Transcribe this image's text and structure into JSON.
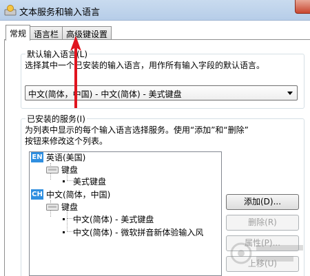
{
  "window": {
    "title": "文本服务和输入语言"
  },
  "tabs": [
    {
      "label": "常规",
      "active": true
    },
    {
      "label": "语言栏",
      "active": false
    },
    {
      "label": "高级键设置",
      "active": false
    }
  ],
  "default_language": {
    "legend": "默认输入语言(L)",
    "description": "选择其中一个已安装的输入语言，用作所有输入字段的默认语言。",
    "selected": "中文(简体，中国) - 中文(简体) - 美式键盘"
  },
  "installed_services": {
    "legend": "已安装的服务(I)",
    "description_line1": "为列表中显示的每个输入语言选择服务。使用“添加”和“删除”",
    "description_line2": "按钮来修改这个列表。",
    "tree": {
      "en_badge": "EN",
      "en_label": "英语(美国)",
      "en_keyboard": "键盘",
      "en_layout": "美式键盘",
      "ch_badge": "CH",
      "ch_label": "中文(简体，中国)",
      "ch_keyboard": "键盘",
      "ch_layout1": "中文(简体) - 美式键盘",
      "ch_layout2": "中文(简体) - 微软拼音新体验输入风"
    },
    "buttons": {
      "add": "添加(D)...",
      "remove": "删除(R)",
      "properties": "属性(P)...",
      "move_up": "上移(U)"
    }
  },
  "colors": {
    "accent": "#2f8fe0",
    "arrow": "#e0141e"
  }
}
